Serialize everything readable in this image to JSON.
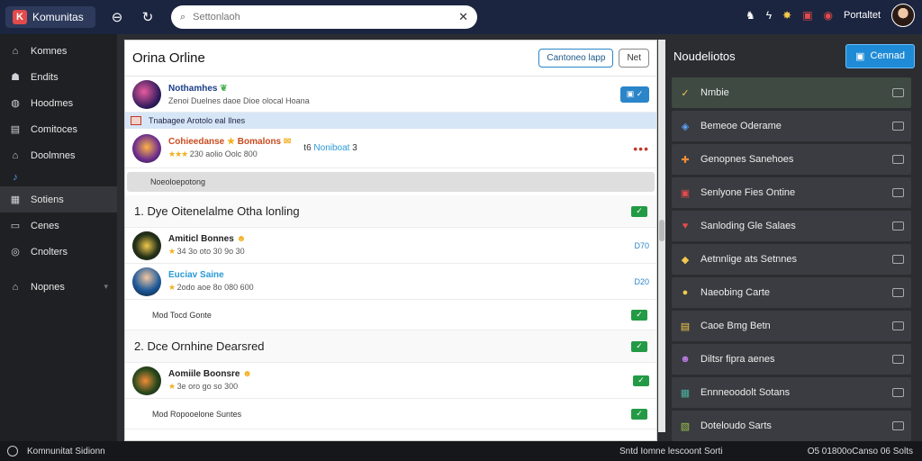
{
  "app": {
    "name": "Komunitas"
  },
  "topbar": {
    "search_placeholder": "Settonlaoh",
    "user_name": "Portaltet"
  },
  "sidebar": {
    "items": [
      {
        "label": "Komnes",
        "icon": "home-icon"
      },
      {
        "label": "Endits",
        "icon": "user-icon"
      },
      {
        "label": "Hoodmes",
        "icon": "gamepad-icon"
      },
      {
        "label": "Comitoces",
        "icon": "controller-icon"
      },
      {
        "label": "Doolmnes",
        "icon": "home-icon"
      },
      {
        "label": "",
        "icon": "music-icon"
      },
      {
        "label": "Sotiens",
        "icon": "grid-icon"
      },
      {
        "label": "Cenes",
        "icon": "monitor-icon"
      },
      {
        "label": "Cnolters",
        "icon": "settings-icon"
      },
      {
        "label": "Nopnes",
        "icon": "home-icon"
      }
    ]
  },
  "main": {
    "title": "Orina Orline",
    "btn_primary": "Cantoneo lapp",
    "btn_secondary": "Net",
    "posts": [
      {
        "name": "Nothamhes",
        "sub": "Zenoi Duelnes daoe Dioe olocal Hoana"
      },
      {
        "name": "Cohieedanse",
        "name2": "Bomalons",
        "sub": "230 aolio Oolc 800",
        "tag1": "t6",
        "tag2": "Noniboat",
        "tag3": "3"
      }
    ],
    "banner_text": "Tnabagee Arotolo eal Ilnes",
    "grey_bar_text": "Noeoloepotong",
    "section1": "Dye Oitenelalme Otha lonling",
    "section1_num": "1.",
    "rows1": [
      {
        "name": "Amiticl Bonnes",
        "sub": "34 3o oto 30 9o 30",
        "val": "D70"
      },
      {
        "name": "Euciav Saine",
        "sub": "2odo aoe 8o 080 600",
        "val": "D20"
      }
    ],
    "simple1": "Mod Tocd Gonte",
    "section2": "Dce Ornhine Dearsred",
    "section2_num": "2.",
    "rows2": [
      {
        "name": "Aomiile Boonsre",
        "sub": "3e oro go so 300"
      }
    ],
    "simple2": "Mod Ropooelone Suntes"
  },
  "right": {
    "title": "Noudeliotos",
    "create_label": "Cennad",
    "items": [
      {
        "label": "Nmbie",
        "icon": "check-icon",
        "color": "#f2c94c",
        "active": true
      },
      {
        "label": "Bemeoe Oderame",
        "icon": "shield-icon",
        "color": "#5ba4ff"
      },
      {
        "label": "Genopnes Sanehoes",
        "icon": "puzzle-icon",
        "color": "#f28c38"
      },
      {
        "label": "Senlyone Fies Ontine",
        "icon": "image-icon",
        "color": "#e34b4b"
      },
      {
        "label": "Sanloding Gle Salaes",
        "icon": "heart-icon",
        "color": "#e34b4b"
      },
      {
        "label": "Aetnnlige ats Setnnes",
        "icon": "gem-icon",
        "color": "#f2c94c"
      },
      {
        "label": "Naeobing Carte",
        "icon": "circle-icon",
        "color": "#f2c94c"
      },
      {
        "label": "Caoe Bmg Betn",
        "icon": "gift-icon",
        "color": "#f2c94c"
      },
      {
        "label": "Diltsr fipra aenes",
        "icon": "avatar-icon",
        "color": "#b97ae3"
      },
      {
        "label": "Ennneoodolt Sotans",
        "icon": "map-icon",
        "color": "#4cb0a0"
      },
      {
        "label": "Doteloudo Sarts",
        "icon": "landscape-icon",
        "color": "#9bc24c"
      }
    ]
  },
  "bottom": {
    "left": "Komnunitat Sidionn",
    "mid": "Sntd Iomne lescoont Sorti",
    "right": "O5 01800oCanso 06 Solts"
  }
}
